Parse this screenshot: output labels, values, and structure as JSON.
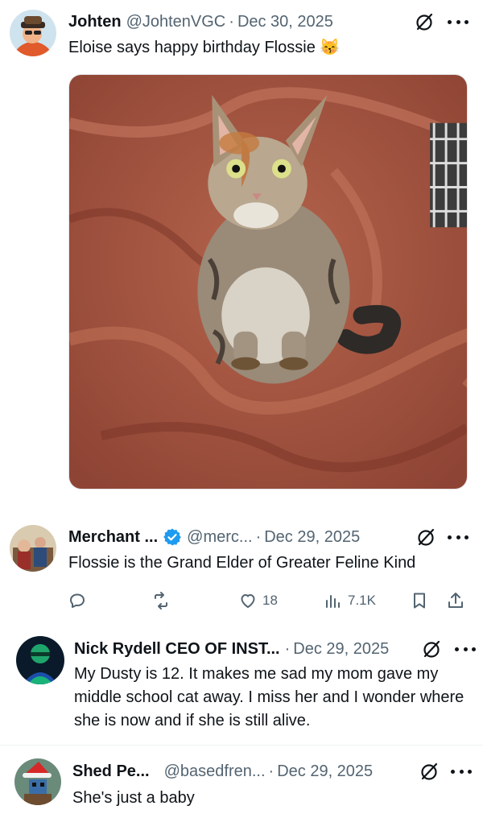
{
  "posts": [
    {
      "name": "Johten",
      "handle": "@JohtenVGC",
      "separator": "·",
      "date": "Dec 30, 2025",
      "text": "Eloise says happy birthday Flossie 😽",
      "image_alt": "Tabby calico cat sitting on a rust-colored blanket",
      "avatar_icon": "avatar-cartoon-person",
      "hide_icon": "hide-reply-icon",
      "more_icon": "more-options-icon"
    },
    {
      "name": "Merchant ...",
      "handle": "@merc...",
      "separator": "·",
      "date": "Dec 29, 2025",
      "text": "Flossie is the Grand Elder of Greater Feline Kind",
      "verified": true,
      "verified_color": "#1d9bf0",
      "actions": {
        "reply_count": "",
        "repost_count": "",
        "like_count": "18",
        "views_count": "7.1K"
      }
    },
    {
      "name": "Nick Rydell CEO OF INST...",
      "separator": "·",
      "date": "Dec 29, 2025",
      "text": "My Dusty is 12. It makes me sad my mom gave my middle school cat away. I miss her and I wonder where she is now and if she is still alive."
    },
    {
      "name": "Shed Pe...",
      "handle": "@basedfren...",
      "separator": "·",
      "date": "Dec 29, 2025",
      "text": "She's just a baby"
    }
  ],
  "colors": {
    "text_primary": "#0f1419",
    "text_secondary": "#536471",
    "verified_blue": "#1d9bf0",
    "divider": "#eff3f4"
  }
}
